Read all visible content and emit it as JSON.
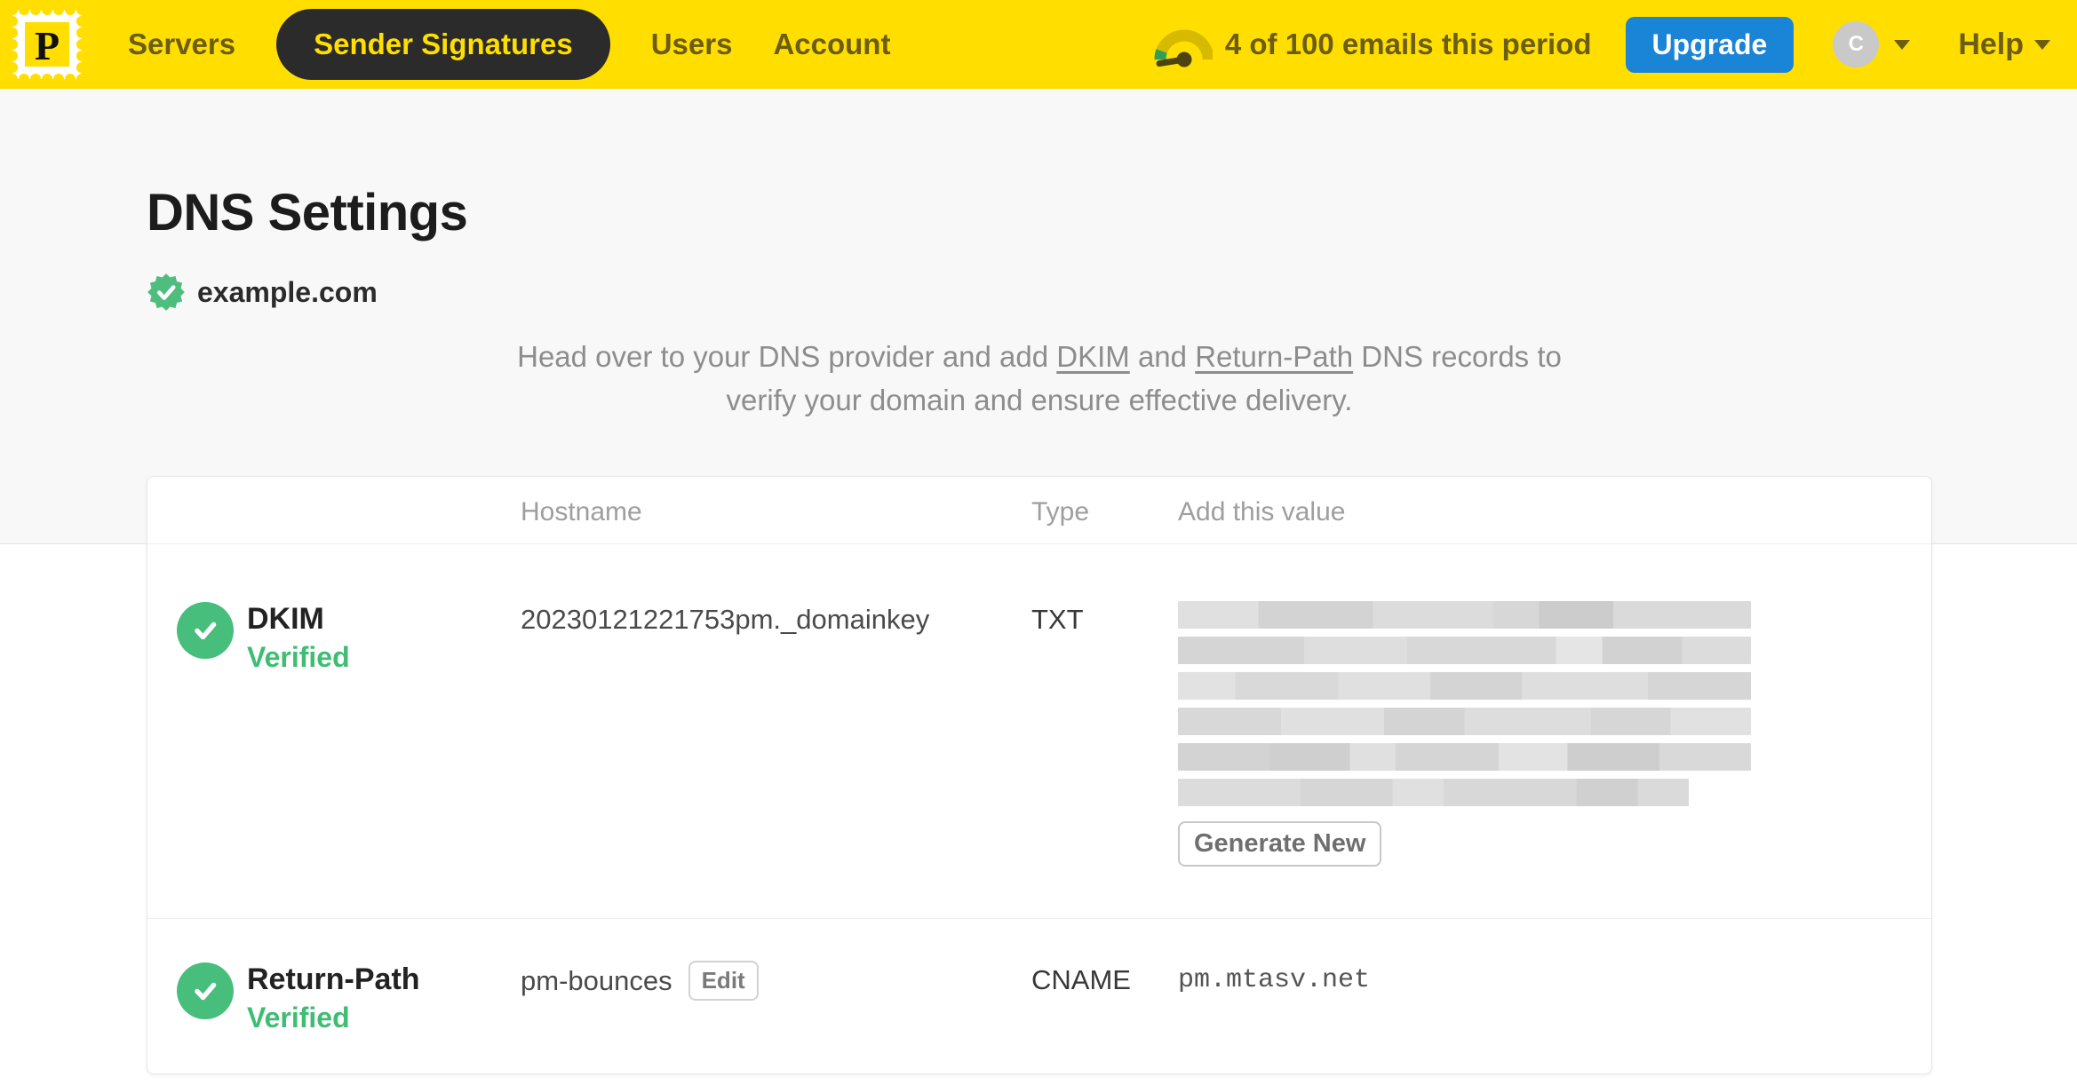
{
  "navbar": {
    "logo_letter": "P",
    "items": [
      {
        "label": "Servers",
        "active": false
      },
      {
        "label": "Sender Signatures",
        "active": true
      },
      {
        "label": "Users",
        "active": false
      },
      {
        "label": "Account",
        "active": false
      }
    ],
    "usage_text": "4 of 100 emails this period",
    "upgrade_label": "Upgrade",
    "avatar_letter": "C",
    "help_label": "Help"
  },
  "page": {
    "title": "DNS Settings",
    "domain": "example.com",
    "description": {
      "prefix": "Head over to your DNS provider and add ",
      "link_dkim": "DKIM",
      "middle": " and ",
      "link_return_path": "Return-Path",
      "suffix_line1": " DNS records to",
      "suffix_line2": "verify your domain and ensure effective delivery."
    }
  },
  "table": {
    "headers": {
      "hostname": "Hostname",
      "type": "Type",
      "value": "Add this value"
    },
    "rows": [
      {
        "name": "DKIM",
        "status": "Verified",
        "hostname": "20230121221753pm._domainkey",
        "type": "TXT",
        "value_redacted": true,
        "action_label": "Generate New"
      },
      {
        "name": "Return-Path",
        "status": "Verified",
        "hostname": "pm-bounces",
        "hostname_action": "Edit",
        "type": "CNAME",
        "value": "pm.mtasv.net"
      }
    ]
  },
  "colors": {
    "brand_yellow": "#FFDE00",
    "nav_active_bg": "#2b2b2b",
    "nav_text": "#6b5d11",
    "upgrade_blue": "#1a84d6",
    "success_green": "#3ebd73",
    "hero_bg": "#f8f8f8"
  }
}
